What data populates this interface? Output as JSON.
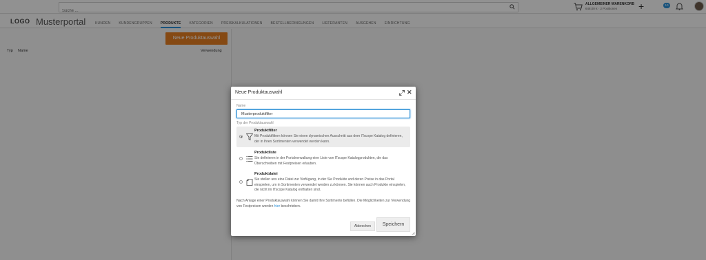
{
  "topbar": {
    "search_placeholder": "Suche ...",
    "cart_title": "ALLGEMEINER WARENKORB",
    "cart_subtitle": "648,00 € · 2 Positionen",
    "notification_count": "10"
  },
  "navbar": {
    "logo": "LOGO",
    "portal_name": "Musterportal",
    "items": [
      {
        "label": "KUNDEN"
      },
      {
        "label": "KUNDENGRUPPEN"
      },
      {
        "label": "PRODUKTE"
      },
      {
        "label": "KATEGORIEN"
      },
      {
        "label": "PREISKALKULATIONEN"
      },
      {
        "label": "BESTELLBEDINGUNGEN"
      },
      {
        "label": "LIEFERANTEN"
      },
      {
        "label": "AUSGEHEN"
      },
      {
        "label": "EINRICHTUNG"
      }
    ],
    "active_item": "PRODUKTE"
  },
  "left_panel": {
    "new_button": "Neue Produktauswahl",
    "columns": {
      "type": "Typ",
      "name": "Name",
      "usage": "Verwendung"
    }
  },
  "modal": {
    "title": "Neue Produktauswahl",
    "name_label": "Name",
    "name_value": "Musterproduktfilter",
    "type_label": "Typ der Produktauswahl",
    "options": [
      {
        "title": "Produktfilter",
        "description": "Mit Produktfiltern können Sie einen dynamischen Ausschnitt aus dem ITscope Katalog definieren, der in Ihren Sortimenten verwendet werden kann.",
        "icon": "funnel-icon",
        "selected": true
      },
      {
        "title": "Produktliste",
        "description": "Sie definieren in der Portalverwaltung eine Liste von ITscope Katalogprodukten, die das Überschreiben mit Festpreisen erlauben.",
        "icon": "list-icon",
        "selected": false
      },
      {
        "title": "Produktdatei",
        "description": "Sie stellen uns eine Datei zur Verfügung, in der Sie Produkte und deren Preise in das Portal einspielen, um in Sortimenten verwendet werden zu können. Sie können auch Produkte einspielen, die nicht im ITscope Katalog enthalten sind.",
        "icon": "file-icon",
        "selected": false
      }
    ],
    "footnote_before": "Nach Anlage einer Produktauswahl können Sie damit Ihre Sortimente befüllen. Die Möglichkeiten zur Verwendung von Festpreisen werden ",
    "footnote_link": "hier",
    "footnote_after": " beschrieben.",
    "cancel_label": "Abbrechen",
    "save_label": "Speichern"
  }
}
